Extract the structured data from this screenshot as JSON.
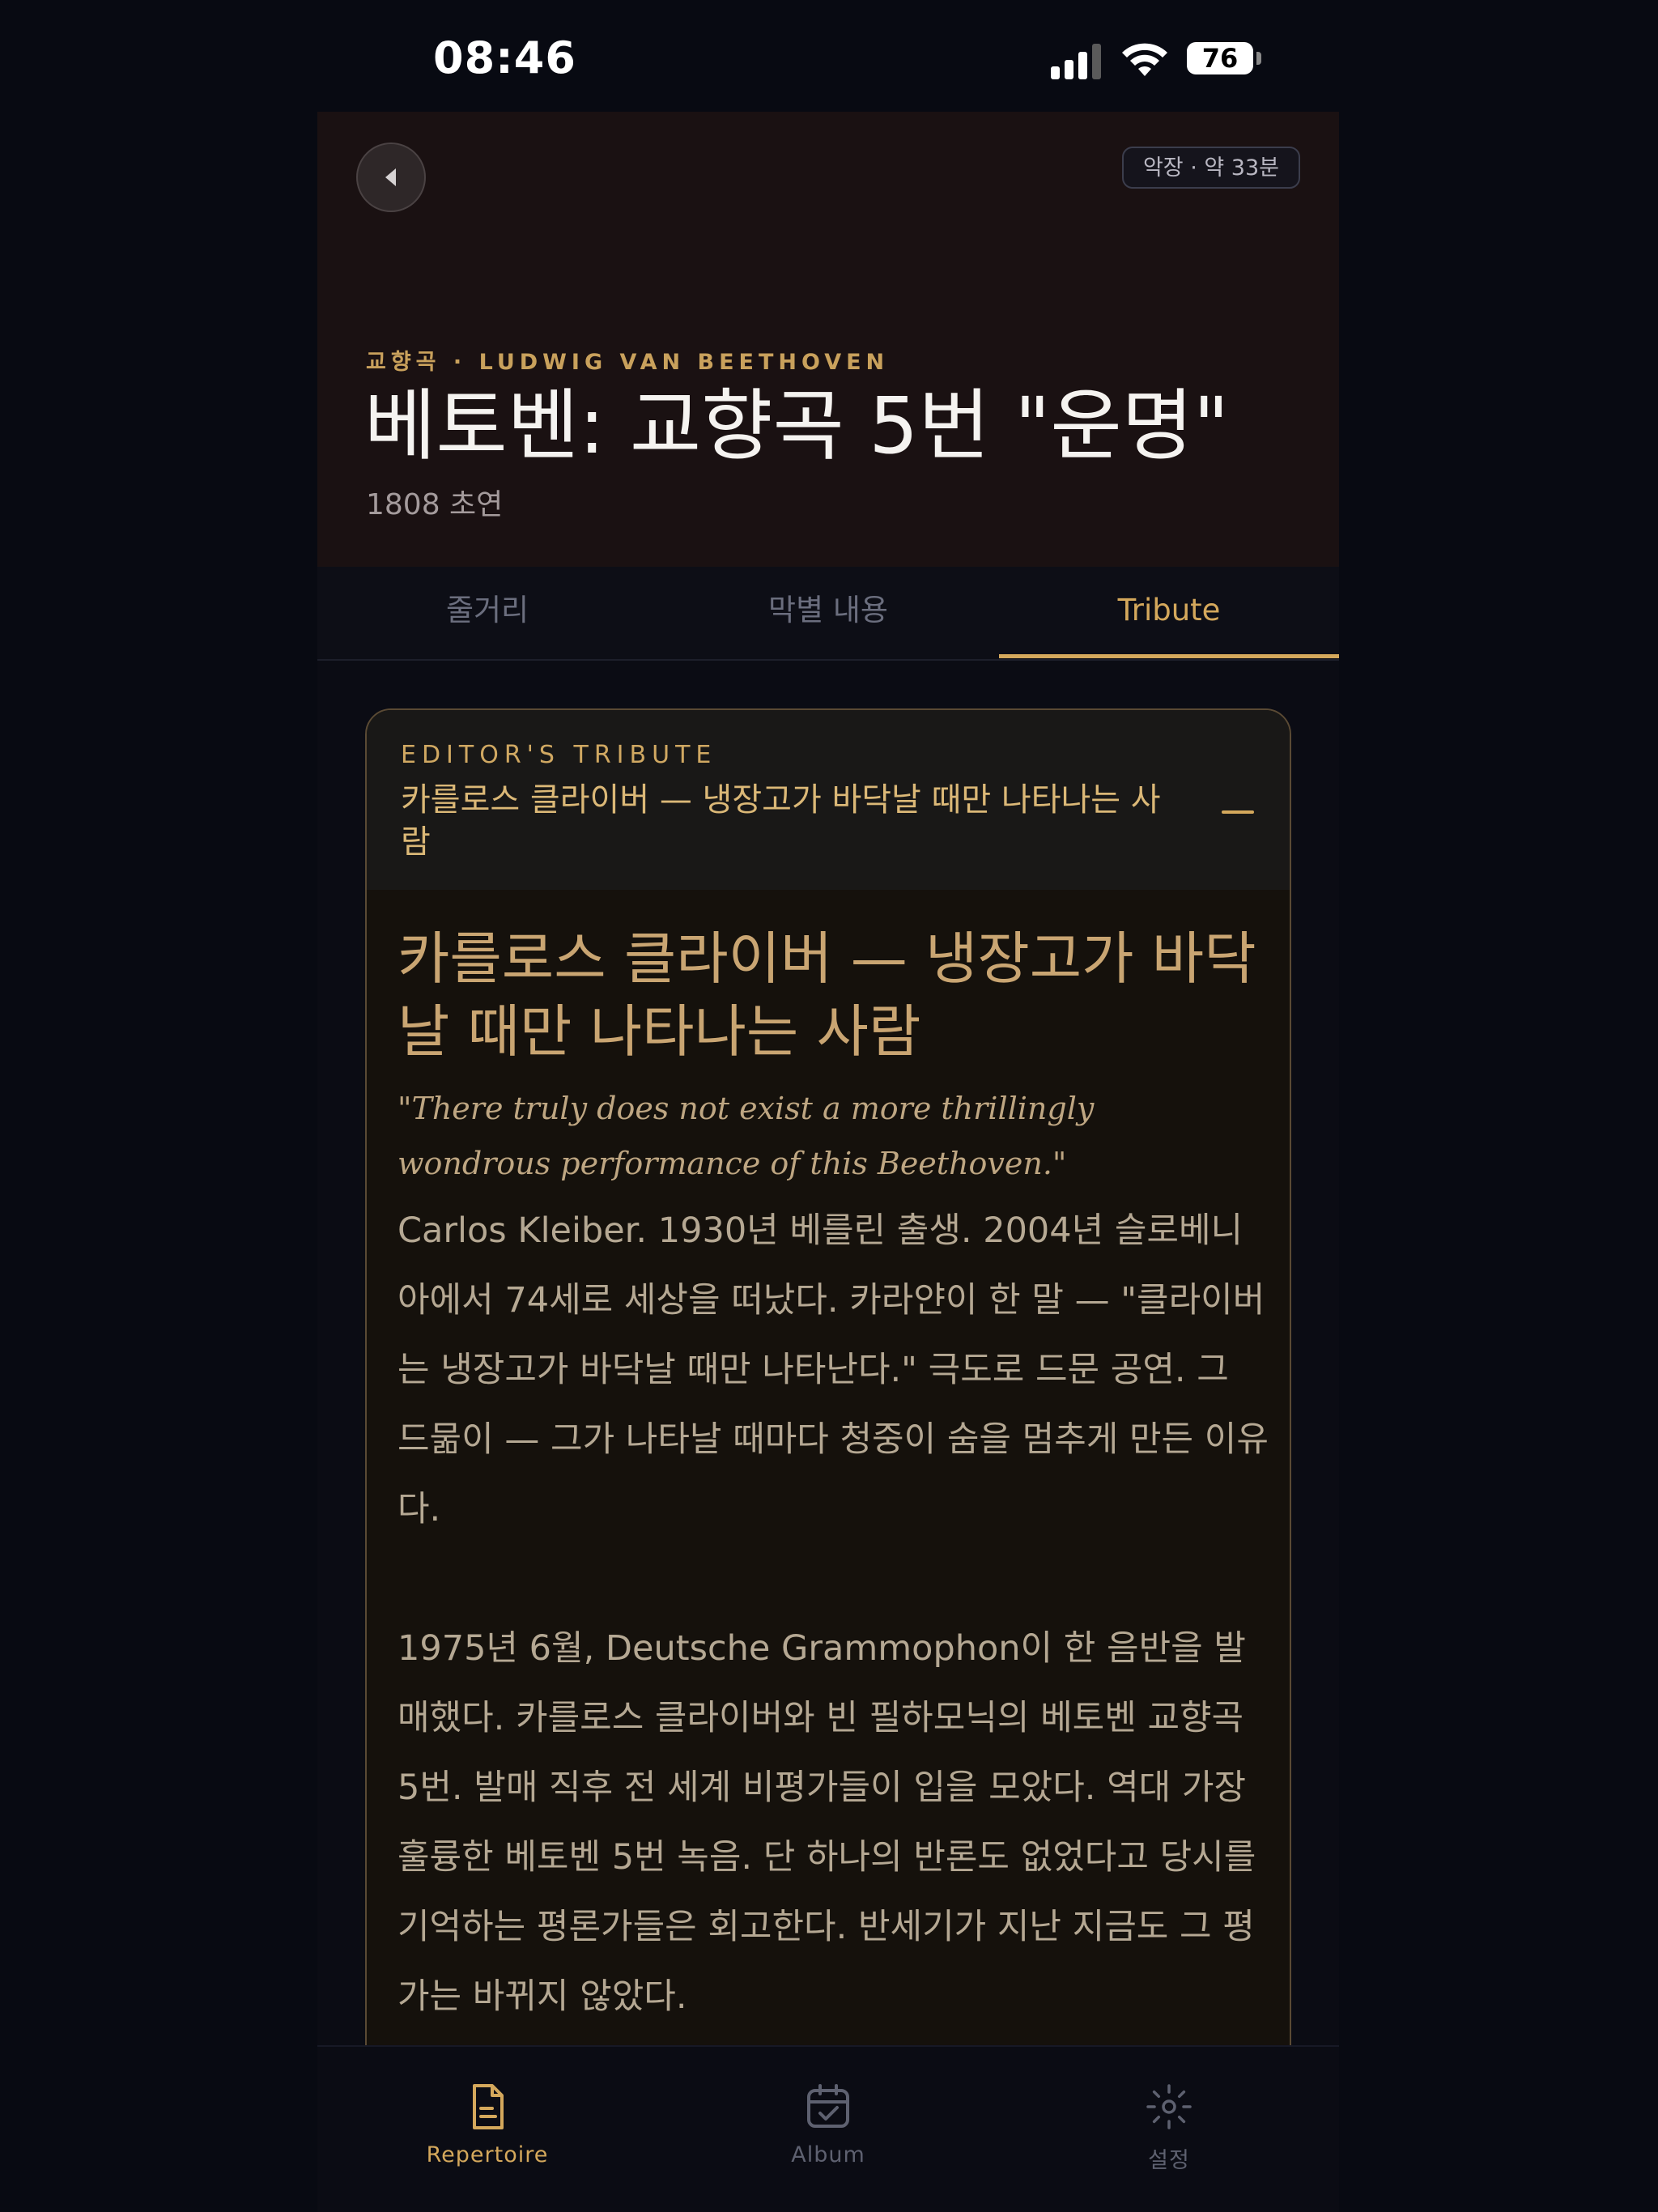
{
  "status_bar": {
    "time": "08:46",
    "battery": "76"
  },
  "header": {
    "duration": "악장 · 약 33분",
    "kicker": "교향곡 · LUDWIG VAN BEETHOVEN",
    "title": "베토벤: 교향곡 5번 \"운명\"",
    "subtitle": "1808 초연"
  },
  "tabs": [
    {
      "label": "줄거리",
      "active": false
    },
    {
      "label": "막별 내용",
      "active": false
    },
    {
      "label": "Tribute",
      "active": true
    }
  ],
  "tribute": {
    "kicker": "EDITOR'S TRIBUTE",
    "header_title": "카를로스 클라이버 — 냉장고가 바닥날 때만 나타나는 사람",
    "title": "카를로스 클라이버 — 냉장고가 바닥날 때만 나타나는 사람",
    "quote": "\"There truly does not exist a more thrillingly wondrous performance of this Beethoven.\"",
    "paragraphs": [
      "Carlos Kleiber. 1930년 베를린 출생. 2004년 슬로베니아에서 74세로 세상을 떠났다. 카라얀이 한 말 — \"클라이버는 냉장고가 바닥날 때만 나타난다.\" 극도로 드문 공연. 그 드묾이 — 그가 나타날 때마다 청중이 숨을 멈추게 만든 이유다.",
      "1975년 6월, Deutsche Grammophon이 한 음반을 발매했다. 카를로스 클라이버와 빈 필하모닉의 베토벤 교향곡 5번. 발매 직후 전 세계 비평가들이 입을 모았다. 역대 가장 훌륭한 베토벤 5번 녹음. 단 하나의 반론도 없었다고 당시를 기억하는 평론가들은 회고한다. 반세기가 지난 지금도 그 평가는 바뀌지 않았다."
    ]
  },
  "bottom_nav": [
    {
      "label": "Repertoire",
      "icon": "document-icon",
      "active": true
    },
    {
      "label": "Album",
      "icon": "calendar-check-icon",
      "active": false
    },
    {
      "label": "설정",
      "icon": "gear-icon",
      "active": false
    }
  ],
  "colors": {
    "accent": "#d4a85c",
    "background": "#0b0c14",
    "hero": "#1a1112"
  }
}
